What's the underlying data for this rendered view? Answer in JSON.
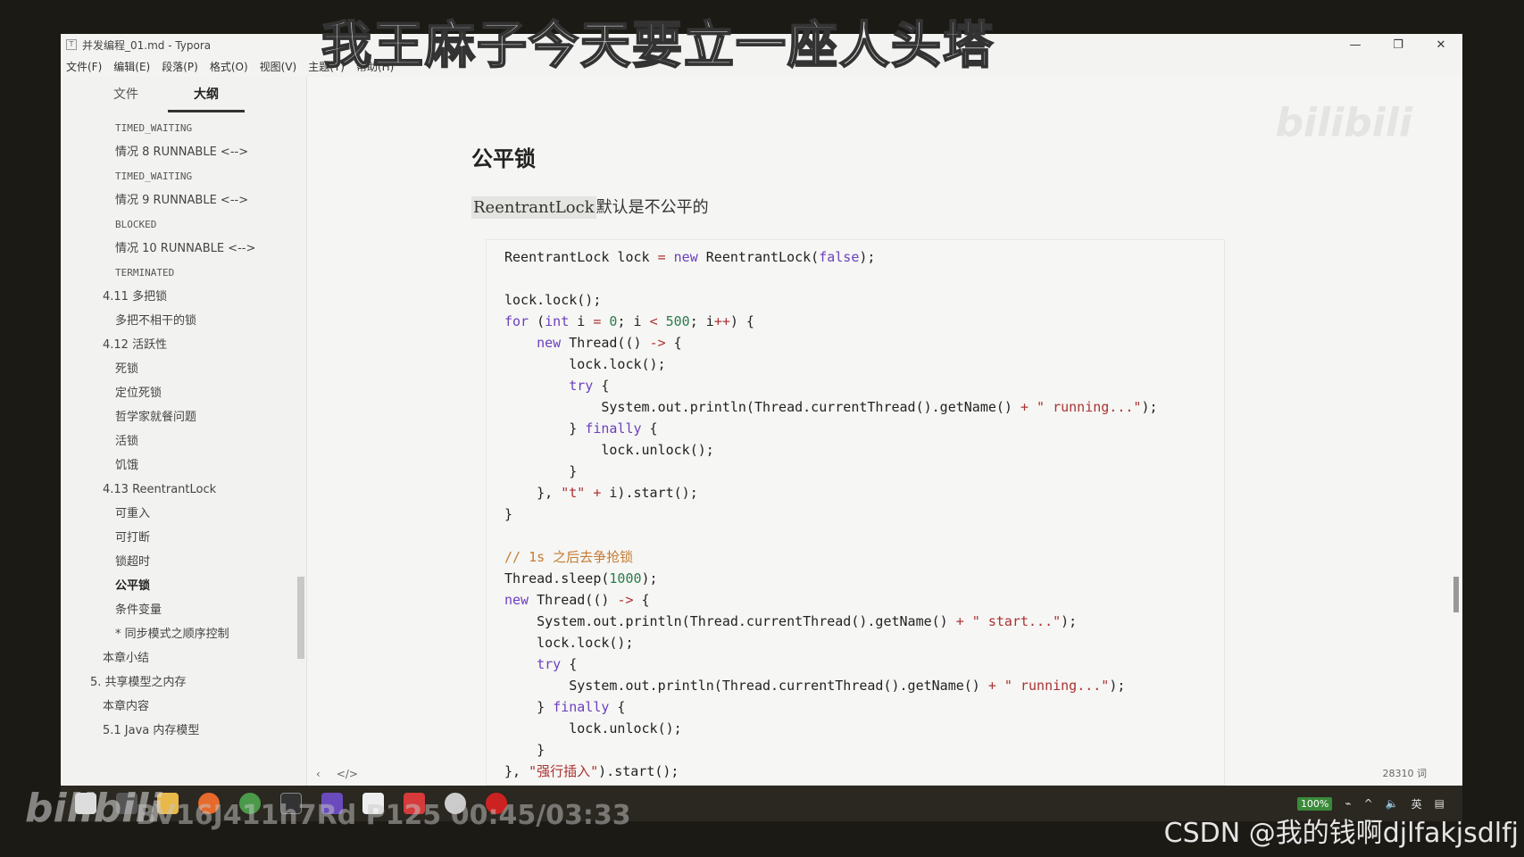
{
  "overlay_title": "我王麻子今天要立一座人头塔",
  "window": {
    "title": "并发编程_01.md - Typora",
    "controls": [
      "—",
      "❐",
      "✕"
    ]
  },
  "menu": [
    "文件(F)",
    "编辑(E)",
    "段落(P)",
    "格式(O)",
    "视图(V)",
    "主题(T)",
    "帮助(H)"
  ],
  "sidebar": {
    "tabs": [
      "文件",
      "大纲"
    ],
    "active_tab": "大纲",
    "outline": [
      {
        "level": "l3",
        "text": "TIMED_WAITING",
        "mono": true
      },
      {
        "level": "l3",
        "text": "情况 8 RUNNABLE <-->"
      },
      {
        "level": "l3",
        "text": "TIMED_WAITING",
        "mono": true
      },
      {
        "level": "l3",
        "text": "情况 9 RUNNABLE <-->"
      },
      {
        "level": "l3",
        "text": "BLOCKED",
        "mono": true
      },
      {
        "level": "l3",
        "text": "情况 10 RUNNABLE <-->"
      },
      {
        "level": "l3",
        "text": "TERMINATED",
        "mono": true
      },
      {
        "level": "l2",
        "text": "4.11 多把锁"
      },
      {
        "level": "l3",
        "text": "多把不相干的锁"
      },
      {
        "level": "l2",
        "text": "4.12 活跃性"
      },
      {
        "level": "l3",
        "text": "死锁"
      },
      {
        "level": "l3",
        "text": "定位死锁"
      },
      {
        "level": "l3",
        "text": "哲学家就餐问题"
      },
      {
        "level": "l3",
        "text": "活锁"
      },
      {
        "level": "l3",
        "text": "饥饿"
      },
      {
        "level": "l2",
        "text": "4.13 ReentrantLock"
      },
      {
        "level": "l3",
        "text": "可重入"
      },
      {
        "level": "l3",
        "text": "可打断"
      },
      {
        "level": "l3",
        "text": "锁超时"
      },
      {
        "level": "l3",
        "text": "公平锁",
        "active": true
      },
      {
        "level": "l3",
        "text": "条件变量"
      },
      {
        "level": "l3",
        "text": "* 同步模式之顺序控制"
      },
      {
        "level": "l2",
        "text": "本章小结"
      },
      {
        "level": "l1",
        "text": "5. 共享模型之内存"
      },
      {
        "level": "l2",
        "text": "本章内容"
      },
      {
        "level": "l2",
        "text": "5.1 Java 内存模型"
      }
    ]
  },
  "document": {
    "heading": "公平锁",
    "para_code": "ReentrantLock",
    "para_text": "默认是不公平的",
    "code_lines": [
      [
        [
          "",
          "ReentrantLock lock "
        ],
        [
          "op",
          "="
        ],
        [
          "kw",
          " new"
        ],
        [
          "",
          " ReentrantLock("
        ],
        [
          "bool",
          "false"
        ],
        [
          "",
          ");"
        ]
      ],
      [],
      [
        [
          "",
          "lock.lock();"
        ]
      ],
      [
        [
          "kw",
          "for"
        ],
        [
          "",
          " ("
        ],
        [
          "kw",
          "int"
        ],
        [
          "",
          " i "
        ],
        [
          "op",
          "="
        ],
        [
          "",
          " "
        ],
        [
          "num",
          "0"
        ],
        [
          "",
          "; i "
        ],
        [
          "op",
          "<"
        ],
        [
          "",
          " "
        ],
        [
          "num",
          "500"
        ],
        [
          "",
          "; i"
        ],
        [
          "op",
          "++"
        ],
        [
          "",
          ") {"
        ]
      ],
      [
        [
          "",
          "    "
        ],
        [
          "kw",
          "new"
        ],
        [
          "",
          " Thread(() "
        ],
        [
          "op",
          "->"
        ],
        [
          "",
          " {"
        ]
      ],
      [
        [
          "",
          "        lock.lock();"
        ]
      ],
      [
        [
          "",
          "        "
        ],
        [
          "kw",
          "try"
        ],
        [
          "",
          " {"
        ]
      ],
      [
        [
          "",
          "            System.out.println(Thread.currentThread().getName() "
        ],
        [
          "op",
          "+"
        ],
        [
          "",
          " "
        ],
        [
          "str",
          "\" running...\""
        ],
        [
          "",
          ");"
        ]
      ],
      [
        [
          "",
          "        } "
        ],
        [
          "kw",
          "finally"
        ],
        [
          "",
          " {"
        ]
      ],
      [
        [
          "",
          "            lock.unlock();"
        ]
      ],
      [
        [
          "",
          "        }"
        ]
      ],
      [
        [
          "",
          "    }, "
        ],
        [
          "str",
          "\"t\""
        ],
        [
          "",
          " "
        ],
        [
          "op",
          "+"
        ],
        [
          "",
          " i).start();"
        ]
      ],
      [
        [
          "",
          "}"
        ]
      ],
      [],
      [
        [
          "cm",
          "// 1s 之后去争抢锁"
        ]
      ],
      [
        [
          "",
          "Thread.sleep("
        ],
        [
          "num",
          "1000"
        ],
        [
          "",
          ");"
        ]
      ],
      [
        [
          "kw",
          "new"
        ],
        [
          "",
          " Thread(() "
        ],
        [
          "op",
          "->"
        ],
        [
          "",
          " {"
        ]
      ],
      [
        [
          "",
          "    System.out.println(Thread.currentThread().getName() "
        ],
        [
          "op",
          "+"
        ],
        [
          "",
          " "
        ],
        [
          "str",
          "\" start...\""
        ],
        [
          "",
          ");"
        ]
      ],
      [
        [
          "",
          "    lock.lock();"
        ]
      ],
      [
        [
          "",
          "    "
        ],
        [
          "kw",
          "try"
        ],
        [
          "",
          " {"
        ]
      ],
      [
        [
          "",
          "        System.out.println(Thread.currentThread().getName() "
        ],
        [
          "op",
          "+"
        ],
        [
          "",
          " "
        ],
        [
          "str",
          "\" running...\""
        ],
        [
          "",
          ");"
        ]
      ],
      [
        [
          "",
          "    } "
        ],
        [
          "kw",
          "finally"
        ],
        [
          "",
          " {"
        ]
      ],
      [
        [
          "",
          "        lock.unlock();"
        ]
      ],
      [
        [
          "",
          "    }"
        ]
      ],
      [
        [
          "",
          "}, "
        ],
        [
          "str",
          "\"强行插入\""
        ],
        [
          "",
          ").start();"
        ]
      ]
    ]
  },
  "statusbar": {
    "left_icons": [
      "‹",
      "</>"
    ],
    "word_count": "28310 词"
  },
  "taskbar": {
    "tray_battery": "100%",
    "tray_lang": "英"
  },
  "watermarks": {
    "bilibili": "bilibili",
    "bv": "BV16J411h7Rd P125 00:45/03:33",
    "csdn": "CSDN @我的钱啊djlfakjsdlfj"
  }
}
